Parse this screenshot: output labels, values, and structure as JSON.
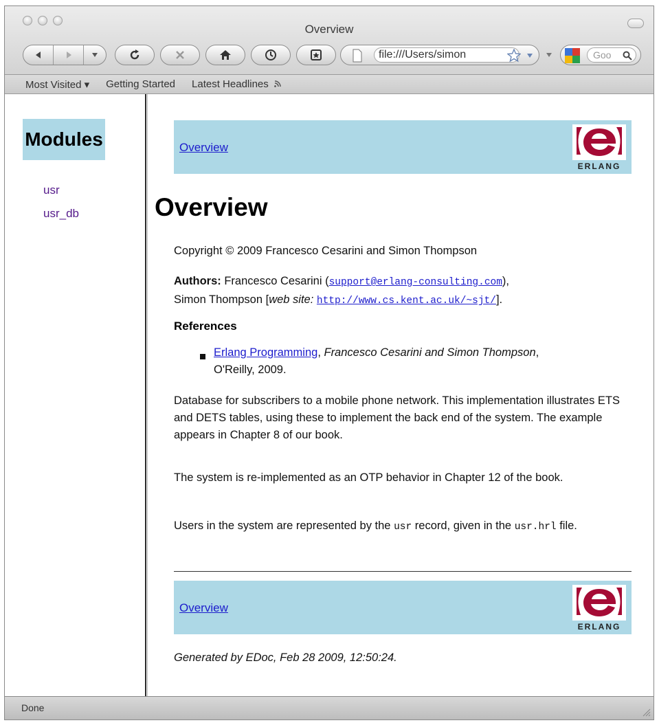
{
  "window": {
    "title": "Overview"
  },
  "toolbar": {
    "url": "file:///Users/simon",
    "search_placeholder": "Goo",
    "icons": [
      "back-icon",
      "forward-icon",
      "reload-icon",
      "stop-icon",
      "home-icon",
      "history-icon",
      "bookmark-icon",
      "page-icon",
      "star-icon",
      "google-icon",
      "search-icon"
    ]
  },
  "bookmarks": {
    "items": [
      {
        "label": "Most Visited ▾"
      },
      {
        "label": "Getting Started"
      },
      {
        "label": "Latest Headlines"
      }
    ]
  },
  "sidebar": {
    "title": "Modules",
    "links": [
      {
        "label": "usr"
      },
      {
        "label": "usr_db"
      }
    ]
  },
  "main": {
    "nav_link": "Overview",
    "logo_text": "ERLANG",
    "logo_color": "#a50b35",
    "heading": "Overview",
    "copyright": "Copyright © 2009 Francesco Cesarini and Simon Thompson",
    "authors_label": "Authors:",
    "author1": "Francesco Cesarini",
    "author1_email": "support@erlang-consulting.com",
    "author2": "Simon Thompson",
    "website_label": "web site:",
    "author2_url": "http://www.cs.kent.ac.uk/~sjt/",
    "references_heading": "References",
    "ref_title": "Erlang Programming",
    "ref_authors": "Francesco Cesarini and Simon Thompson",
    "ref_publisher": "O'Reilly, 2009.",
    "para1": "Database for subscribers to a mobile phone network. This implementation illustrates ETS and DETS tables, using these to implement the back end of the system. The example appears in Chapter 8 of our book.",
    "para2": "The system is re-implemented as an OTP behavior in Chapter 12 of the book.",
    "para3_pre": "Users in the system are represented by the ",
    "para3_code1": "usr",
    "para3_mid": " record, given in the ",
    "para3_code2": "usr.hrl",
    "para3_post": " file.",
    "footer_nav_link": "Overview",
    "generated": "Generated by EDoc, Feb 28 2009, 12:50:24."
  },
  "status": {
    "text": "Done"
  },
  "colors": {
    "nav_background": "#add8e6",
    "link": "#1c1ccc",
    "visited_link": "#551a8b"
  }
}
